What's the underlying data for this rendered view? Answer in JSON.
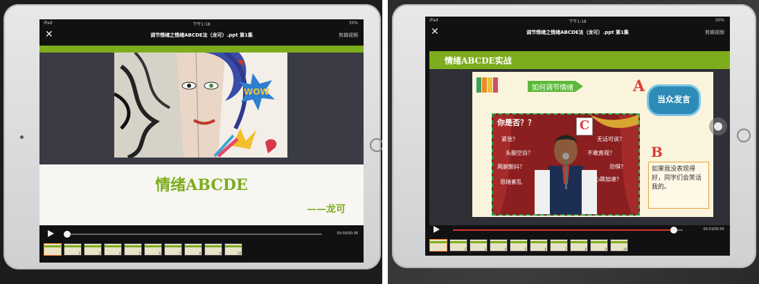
{
  "left": {
    "status": {
      "device": "iPad",
      "time": "下午1:18",
      "battery": "30%"
    },
    "title": "调节情绪之情绪ABCDE法（龙可）.ppt 第1集",
    "edit_label": "剪辑视频",
    "slide": {
      "title": "情绪ABCDE",
      "author": "——龙可",
      "art_text": "WOW"
    },
    "time_display": "00:00/00:36",
    "progress": 0,
    "thumbs": [
      {
        "num": ""
      },
      {
        "num": "2"
      },
      {
        "num": "3"
      },
      {
        "num": "4"
      },
      {
        "num": "5"
      },
      {
        "num": "6"
      },
      {
        "num": "7"
      },
      {
        "num": "8"
      },
      {
        "num": "9"
      },
      {
        "num": "10"
      }
    ]
  },
  "right": {
    "status": {
      "device": "iPad",
      "time": "下午1:18",
      "battery": "30%"
    },
    "title": "调节情绪之情绪ABCDE法（龙可）.ppt 第1集",
    "edit_label": "剪辑视频",
    "slide": {
      "header": "情绪ABCDE实战",
      "tag": "如何调节情绪",
      "bubble": "当众发言",
      "letter_a": "A",
      "letter_b": "B",
      "letter_c": "C",
      "question": "你是否？？",
      "words": [
        "紧张？",
        "头脑空白？",
        "两腿颤抖？",
        "思绪紊乱",
        "无话可说？",
        "不敢直视？",
        "恐惧？",
        "心跳加速？"
      ],
      "b_text": "如果我没表现得好，同学们会笑话我的。"
    },
    "time_display": "00:53/00:55",
    "progress": 0.96,
    "thumbs": [
      {
        "num": ""
      },
      {
        "num": "2"
      },
      {
        "num": "3"
      },
      {
        "num": "4"
      },
      {
        "num": "5"
      },
      {
        "num": "6"
      },
      {
        "num": "7"
      },
      {
        "num": "8"
      },
      {
        "num": "9"
      },
      {
        "num": "10"
      }
    ]
  },
  "colors": {
    "slide_green": "#7dad1c",
    "progress_red": "#e0332b",
    "thumb_active": "#ff8a2a"
  }
}
